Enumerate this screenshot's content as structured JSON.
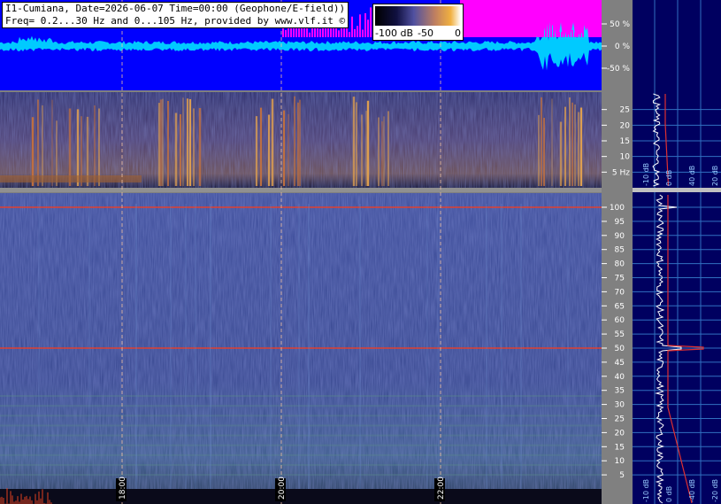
{
  "header": {
    "line1": "I1-Cumiana, Date=2026-06-07 Time=00:00 (Geophone/E-field))",
    "line2": "Freq= 0.2...30 Hz and 0...105 Hz, provided by www.vlf.it ©"
  },
  "colorbar": {
    "labels": [
      "-100 dB",
      "-50",
      "0"
    ]
  },
  "colors": {
    "amp_bg": "#0000ff",
    "amp_top": "#ff00ff",
    "trace": "#00e0ff",
    "right_panel": "#000060"
  },
  "chart_data": [
    {
      "type": "line",
      "name": "amplitude",
      "y_tick_labels": [
        "50 %",
        "0 %",
        "-50 %"
      ],
      "y_ticks": [
        50,
        0,
        -50
      ],
      "ylim": [
        -100,
        100
      ]
    },
    {
      "type": "heatmap",
      "name": "spectrogram-low",
      "y_tick_labels": [
        "25",
        "20",
        "15",
        "10",
        "5 Hz"
      ],
      "y_ticks": [
        25,
        20,
        15,
        10,
        5
      ],
      "ylim": [
        0,
        30
      ]
    },
    {
      "type": "heatmap",
      "name": "spectrogram-high",
      "y_tick_labels": [
        "100",
        "95",
        "90",
        "85",
        "80",
        "75",
        "70",
        "65",
        "60",
        "55",
        "50",
        "45",
        "40",
        "35",
        "30",
        "25",
        "20",
        "15",
        "10",
        "5"
      ],
      "y_ticks": [
        100,
        95,
        90,
        85,
        80,
        75,
        70,
        65,
        60,
        55,
        50,
        45,
        40,
        35,
        30,
        25,
        20,
        15,
        10,
        5
      ],
      "ylim": [
        0,
        105
      ],
      "time_labels": [
        "18:00",
        "20:00",
        "22:00"
      ]
    },
    {
      "type": "line",
      "name": "spectrum-profiles",
      "x_tick_labels_low": [
        "-10 dB",
        "0 dB",
        "40 dB",
        "20 dB"
      ],
      "x_tick_labels_high": [
        "-10 dB",
        "0 dB",
        "-40 dB",
        "-20 dB"
      ]
    }
  ]
}
